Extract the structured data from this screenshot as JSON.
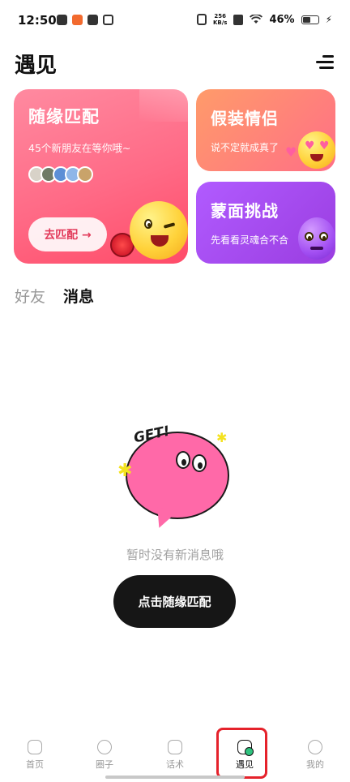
{
  "status_bar": {
    "time": "12:50",
    "net_speed_value": "256",
    "net_speed_unit": "KB/s",
    "battery": "46%"
  },
  "header": {
    "title": "遇见"
  },
  "cards": {
    "random_match": {
      "title": "随缘匹配",
      "subtitle": "45个新朋友在等你哦~",
      "button_label": "去匹配 →",
      "avatar_count": 5
    },
    "fake_couple": {
      "title": "假装情侣",
      "subtitle": "说不定就成真了"
    },
    "masked_challenge": {
      "title": "蒙面挑战",
      "subtitle": "先看看灵魂合不合"
    }
  },
  "tabs": [
    {
      "label": "好友",
      "active": false
    },
    {
      "label": "消息",
      "active": true
    }
  ],
  "empty_state": {
    "illustration_text": "GET!",
    "message": "暂时没有新消息哦",
    "cta_label": "点击随缘匹配"
  },
  "bottom_nav": [
    {
      "label": "首页",
      "icon": "home-icon",
      "active": false
    },
    {
      "label": "圈子",
      "icon": "circle-icon",
      "active": false
    },
    {
      "label": "话术",
      "icon": "book-icon",
      "active": false
    },
    {
      "label": "遇见",
      "icon": "chat-icon",
      "active": true
    },
    {
      "label": "我的",
      "icon": "profile-icon",
      "active": false
    }
  ],
  "colors": {
    "match_card": "#ff6a86",
    "fake_card": "#ff8a78",
    "mask_card": "#a64be8",
    "cta": "#161616",
    "highlight": "#e5222b"
  }
}
